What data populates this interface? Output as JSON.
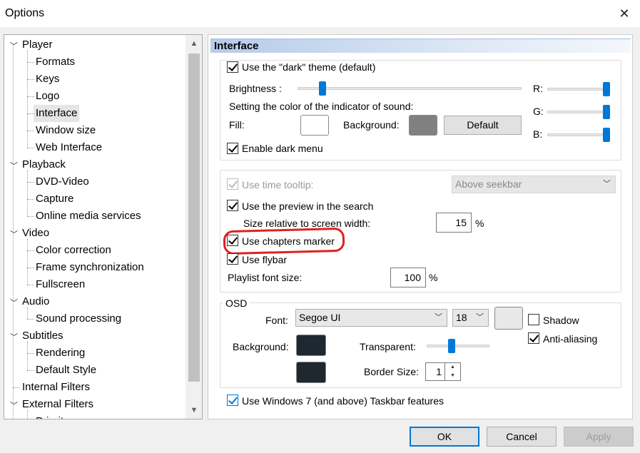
{
  "window": {
    "title": "Options"
  },
  "icons": {
    "close": "close-icon",
    "check": "check-icon",
    "chevron": "chevron-down-icon"
  },
  "tree": [
    {
      "label": "Player",
      "level": 0,
      "expanded": true
    },
    {
      "label": "Formats",
      "level": 1
    },
    {
      "label": "Keys",
      "level": 1
    },
    {
      "label": "Logo",
      "level": 1
    },
    {
      "label": "Interface",
      "level": 1,
      "selected": true
    },
    {
      "label": "Window size",
      "level": 1
    },
    {
      "label": "Web Interface",
      "level": 1
    },
    {
      "label": "Playback",
      "level": 0,
      "expanded": true
    },
    {
      "label": "DVD-Video",
      "level": 1
    },
    {
      "label": "Capture",
      "level": 1
    },
    {
      "label": "Online media services",
      "level": 1
    },
    {
      "label": "Video",
      "level": 0,
      "expanded": true
    },
    {
      "label": "Color correction",
      "level": 1
    },
    {
      "label": "Frame synchronization",
      "level": 1
    },
    {
      "label": "Fullscreen",
      "level": 1
    },
    {
      "label": "Audio",
      "level": 0,
      "expanded": true
    },
    {
      "label": "Sound processing",
      "level": 1
    },
    {
      "label": "Subtitles",
      "level": 0,
      "expanded": true
    },
    {
      "label": "Rendering",
      "level": 1
    },
    {
      "label": "Default Style",
      "level": 1
    },
    {
      "label": "Internal Filters",
      "level": 0
    },
    {
      "label": "External Filters",
      "level": 0,
      "expanded": true
    },
    {
      "label": "Priority",
      "level": 1
    }
  ],
  "page": {
    "title": "Interface",
    "theme": {
      "dark_theme_label": "Use the \"dark\" theme (default)",
      "dark_theme_checked": true,
      "brightness_label": "Brightness :",
      "brightness_level": 0.1,
      "sound_indicator_label": "Setting the color of the indicator of sound:",
      "fill_label": "Fill:",
      "fill_color": "#ffffff",
      "background_label": "Background:",
      "background_color": "#808080",
      "default_button": "Default",
      "r_label": "R:",
      "g_label": "G:",
      "b_label": "B:",
      "r_level": 1.0,
      "g_level": 1.0,
      "b_level": 1.0,
      "dark_menu_label": "Enable dark menu",
      "dark_menu_checked": true
    },
    "seekbar": {
      "time_tooltip_label": "Use time tooltip:",
      "time_tooltip_checked": true,
      "time_tooltip_enabled": false,
      "tooltip_position": "Above seekbar",
      "preview_label": "Use the preview in the search",
      "preview_checked": true,
      "size_label": "Size relative to screen width:",
      "size_value": "15",
      "size_unit": "%",
      "chapters_label": "Use chapters marker",
      "chapters_checked": true,
      "flybar_label": "Use flybar",
      "flybar_checked": true,
      "playlist_font_label": "Playlist font size:",
      "playlist_font_value": "100",
      "playlist_font_unit": "%"
    },
    "osd": {
      "group_label": "OSD",
      "font_label": "Font:",
      "font_value": "Segoe UI",
      "size_value": "18",
      "font_color": "#e8e8e8",
      "shadow_label": "Shadow",
      "shadow_checked": false,
      "antialias_label": "Anti-aliasing",
      "antialias_checked": true,
      "background_label": "Background:",
      "background_color": "#1e2830",
      "border_color": "#1e2830",
      "transparent_label": "Transparent:",
      "transparent_level": 0.38,
      "border_size_label": "Border Size:",
      "border_size_value": "1"
    },
    "taskbar_label": "Use Windows 7 (and above) Taskbar features",
    "taskbar_checked": true
  },
  "buttons": {
    "ok": "OK",
    "cancel": "Cancel",
    "apply": "Apply"
  },
  "colors": {
    "accent": "#0078d7",
    "highlight_oval": "#e02020"
  }
}
